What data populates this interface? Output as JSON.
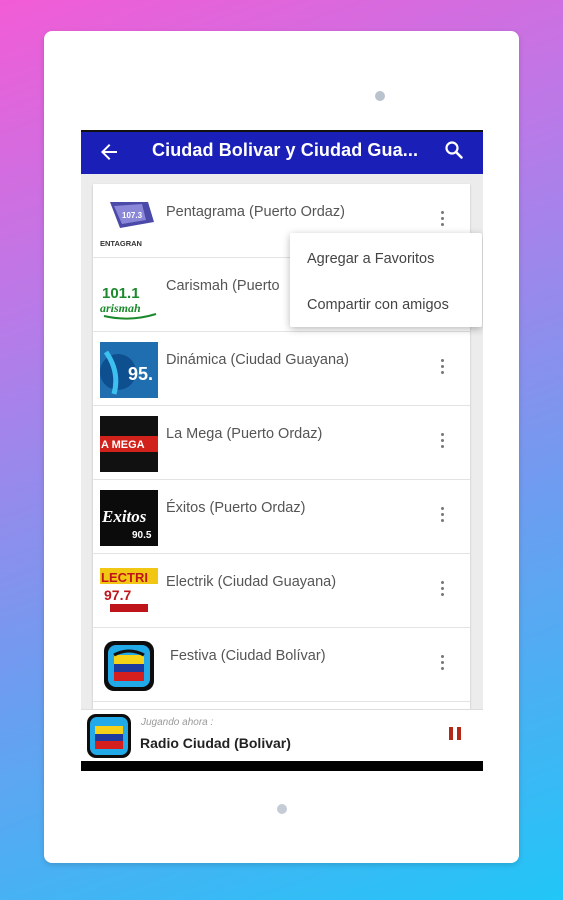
{
  "appbar": {
    "title": "Ciudad Bolivar y Ciudad Gua...",
    "color": "#1a1fb8"
  },
  "stations": [
    {
      "label": "Pentagrama (Puerto Ordaz)",
      "logo_text": "ENTAGRAN",
      "logo_badge": "107.3"
    },
    {
      "label": "Carismah (Puerto",
      "logo_text": "101.1",
      "logo_sub": "arismah"
    },
    {
      "label": "Dinámica (Ciudad Guayana)",
      "logo_text": "95."
    },
    {
      "label": "La Mega (Puerto Ordaz)",
      "logo_text": "A MEGA"
    },
    {
      "label": "Éxitos (Puerto Ordaz)",
      "logo_text": "Exitos",
      "logo_sub": "90.5"
    },
    {
      "label": "Electrik (Ciudad Guayana)",
      "logo_text": "LECTRI",
      "logo_sub": "97.7"
    },
    {
      "label": "Festiva (Ciudad Bolívar)"
    }
  ],
  "context_menu": {
    "items": [
      "Agregar a Favoritos",
      "Compartir con amigos"
    ]
  },
  "player": {
    "status": "Jugando ahora :",
    "title": "Radio Ciudad (Bolivar)",
    "pause_color": "#b22a17"
  },
  "icons": {
    "back": "arrow-left-icon",
    "search": "search-icon",
    "more": "more-vert-icon",
    "pause": "pause-icon"
  }
}
